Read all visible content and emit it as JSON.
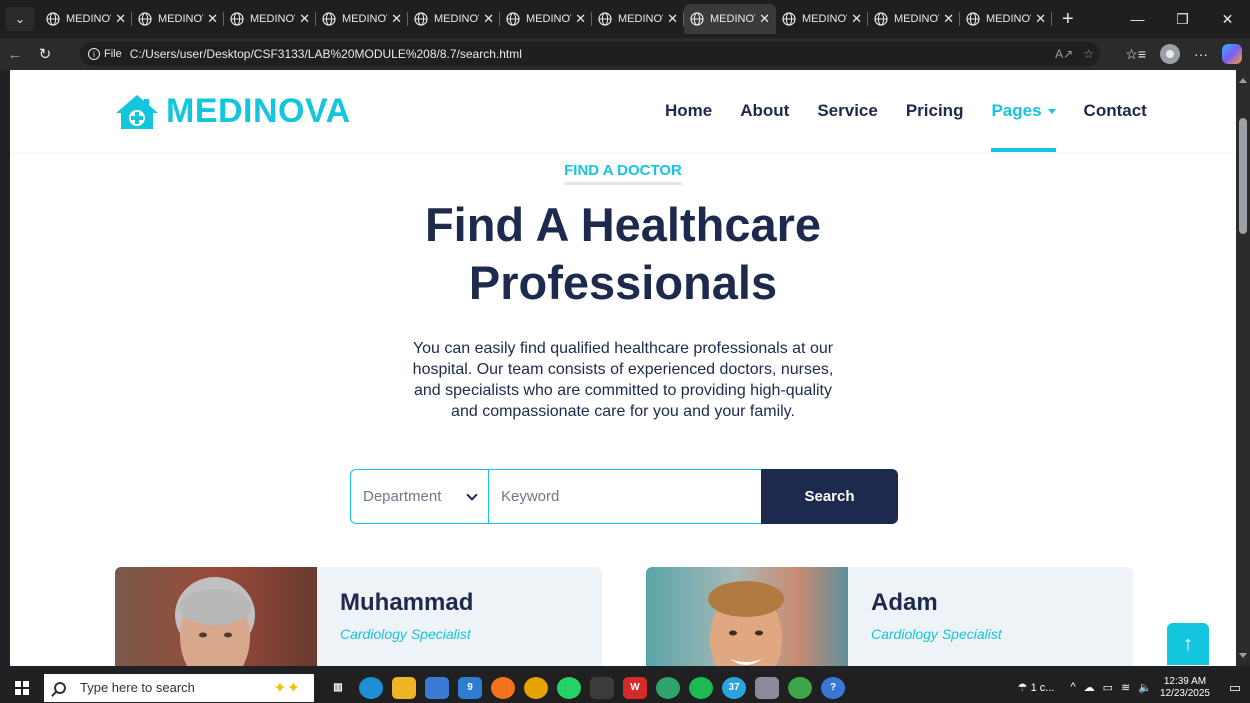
{
  "browser": {
    "tabs": [
      {
        "title": "MEDINOVA",
        "active": false
      },
      {
        "title": "MEDINOVA",
        "active": false
      },
      {
        "title": "MEDINOVA",
        "active": false
      },
      {
        "title": "MEDINOVA",
        "active": false
      },
      {
        "title": "MEDINOVA",
        "active": false
      },
      {
        "title": "MEDINOVA",
        "active": false
      },
      {
        "title": "MEDINOVA",
        "active": false
      },
      {
        "title": "MEDINOVA",
        "active": true
      },
      {
        "title": "MEDINOVA",
        "active": false
      },
      {
        "title": "MEDINOVA",
        "active": false
      },
      {
        "title": "MEDINOVA",
        "active": false
      }
    ],
    "new_tab": "+",
    "address": {
      "scheme_label": "File",
      "url": "C:/Users/user/Desktop/CSF3133/LAB%20MODULE%208/8.7/search.html"
    }
  },
  "site": {
    "brand": "MEDINOVA",
    "nav": [
      {
        "label": "Home",
        "active": false
      },
      {
        "label": "About",
        "active": false
      },
      {
        "label": "Service",
        "active": false
      },
      {
        "label": "Pricing",
        "active": false
      },
      {
        "label": "Pages",
        "active": true,
        "dropdown": true
      },
      {
        "label": "Contact",
        "active": false
      }
    ],
    "hero": {
      "eyebrow": "FIND A DOCTOR",
      "title_line1": "Find A Healthcare",
      "title_line2": "Professionals",
      "description": "You can easily find qualified healthcare professionals at our hospital. Our team consists of experienced doctors, nurses, and specialists who are committed to providing high-quality and compassionate care for you and your family."
    },
    "search": {
      "department_placeholder": "Department",
      "keyword_placeholder": "Keyword",
      "button_label": "Search"
    },
    "doctors": [
      {
        "name": "Muhammad",
        "specialty": "Cardiology Specialist"
      },
      {
        "name": "Adam",
        "specialty": "Cardiology Specialist"
      }
    ],
    "back_to_top": "↑",
    "colors": {
      "primary": "#13c5dd",
      "dark": "#1d2a4d",
      "card_bg": "#eef3f8"
    }
  },
  "taskbar": {
    "search_placeholder": "Type here to search",
    "weather": "1 c...",
    "time": "12:39 AM",
    "date": "12/23/2025",
    "badge_mail": "9",
    "badge_telegram": "37"
  }
}
